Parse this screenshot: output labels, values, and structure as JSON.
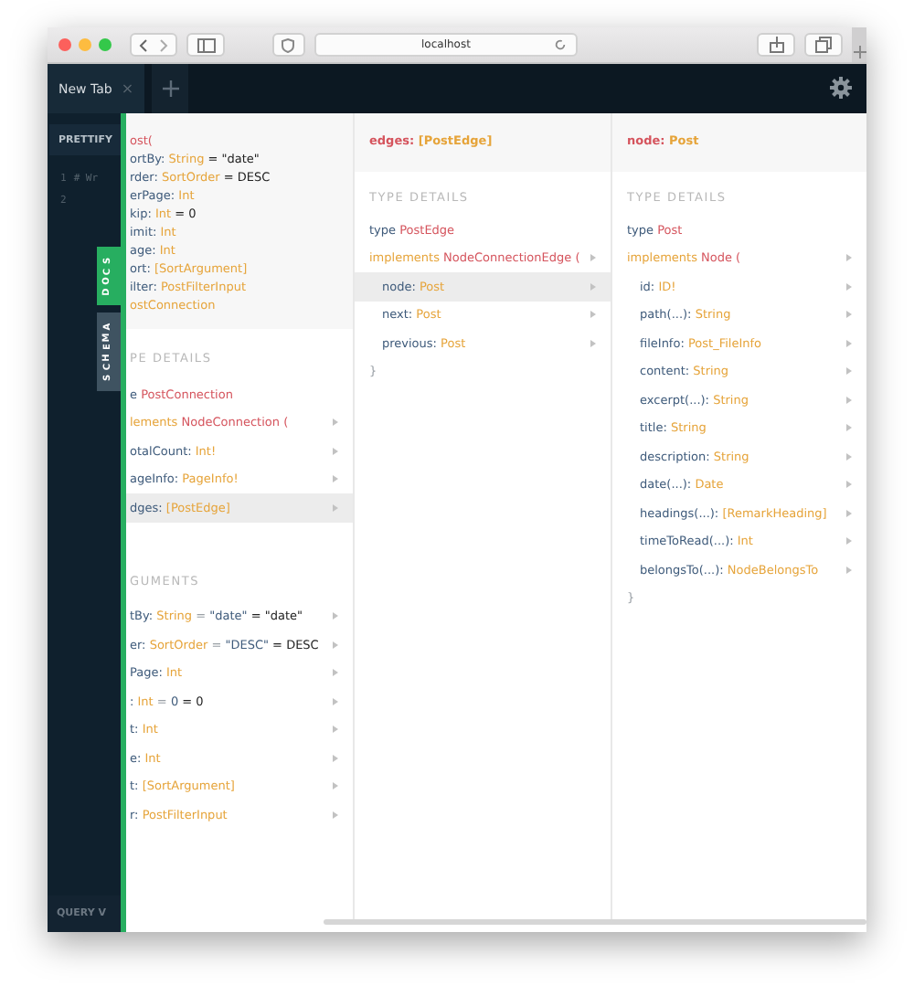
{
  "browser": {
    "url": "localhost"
  },
  "app_tabs": [
    {
      "label": "New Tab",
      "close": "×",
      "selected": true
    }
  ],
  "editor": {
    "prettify": "PRETTIFY",
    "line_numbers": [
      "1",
      "2"
    ],
    "code": [
      "# Wr"
    ],
    "bottom_label": "QUERY V"
  },
  "side_tabs": [
    {
      "label": "DOCS",
      "selected": true
    },
    {
      "label": "SCHEMA",
      "selected": false
    }
  ],
  "columns": [
    {
      "header": [
        [
          {
            "text": "ost(",
            "kind": "def"
          }
        ],
        [
          {
            "text": "ortBy: ",
            "kind": "field"
          },
          {
            "text": "String",
            "kind": "type"
          },
          {
            "text": " = \"date\"",
            "kind": "plain"
          }
        ],
        [
          {
            "text": "rder: ",
            "kind": "field"
          },
          {
            "text": "SortOrder",
            "kind": "type"
          },
          {
            "text": " = DESC",
            "kind": "plain"
          }
        ],
        [
          {
            "text": "erPage: ",
            "kind": "field"
          },
          {
            "text": "Int",
            "kind": "type"
          }
        ],
        [
          {
            "text": "kip: ",
            "kind": "field"
          },
          {
            "text": "Int",
            "kind": "type"
          },
          {
            "text": " = 0",
            "kind": "plain"
          }
        ],
        [
          {
            "text": "imit: ",
            "kind": "field"
          },
          {
            "text": "Int",
            "kind": "type"
          }
        ],
        [
          {
            "text": "age: ",
            "kind": "field"
          },
          {
            "text": "Int",
            "kind": "type"
          }
        ],
        [
          {
            "text": "ort: ",
            "kind": "field"
          },
          {
            "text": "[SortArgument]",
            "kind": "type"
          }
        ],
        [
          {
            "text": "ilter: ",
            "kind": "field"
          },
          {
            "text": "PostFilterInput",
            "kind": "type"
          }
        ],
        [
          {
            "text": "ostConnection",
            "kind": "type"
          }
        ]
      ],
      "sections": [
        {
          "title": "PE DETAILS",
          "rows": [
            {
              "parts": [
                {
                  "text": "e ",
                  "kind": "field"
                },
                {
                  "text": "PostConnection",
                  "kind": "def"
                }
              ],
              "arrow": false,
              "selected": false
            },
            {
              "parts": [
                {
                  "text": "lements ",
                  "kind": "type"
                },
                {
                  "text": "NodeConnection (",
                  "kind": "def"
                }
              ],
              "arrow": true,
              "selected": false
            },
            {
              "parts": [
                {
                  "text": "otalCount: ",
                  "kind": "field"
                },
                {
                  "text": "Int!",
                  "kind": "type"
                }
              ],
              "arrow": true,
              "selected": false
            },
            {
              "parts": [
                {
                  "text": "ageInfo: ",
                  "kind": "field"
                },
                {
                  "text": "PageInfo!",
                  "kind": "type"
                }
              ],
              "arrow": true,
              "selected": false
            },
            {
              "parts": [
                {
                  "text": "dges: ",
                  "kind": "field"
                },
                {
                  "text": "[PostEdge]",
                  "kind": "type"
                }
              ],
              "arrow": true,
              "selected": true
            }
          ]
        },
        {
          "title": "GUMENTS",
          "rows": [
            {
              "parts": [
                {
                  "text": "tBy: ",
                  "kind": "field"
                },
                {
                  "text": "String",
                  "kind": "type"
                },
                {
                  "text": " = ",
                  "kind": "muted"
                },
                {
                  "text": "\"date\"",
                  "kind": "field"
                },
                {
                  "text": " = \"date\"",
                  "kind": "plain"
                }
              ],
              "arrow": true,
              "selected": false
            },
            {
              "parts": [
                {
                  "text": "er: ",
                  "kind": "field"
                },
                {
                  "text": "SortOrder",
                  "kind": "type"
                },
                {
                  "text": " = ",
                  "kind": "muted"
                },
                {
                  "text": "\"DESC\"",
                  "kind": "field"
                },
                {
                  "text": " = DESC",
                  "kind": "plain"
                }
              ],
              "arrow": true,
              "selected": false
            },
            {
              "parts": [
                {
                  "text": "Page: ",
                  "kind": "field"
                },
                {
                  "text": "Int",
                  "kind": "type"
                }
              ],
              "arrow": true,
              "selected": false
            },
            {
              "parts": [
                {
                  "text": ": ",
                  "kind": "field"
                },
                {
                  "text": "Int",
                  "kind": "type"
                },
                {
                  "text": " = ",
                  "kind": "muted"
                },
                {
                  "text": "0",
                  "kind": "field"
                },
                {
                  "text": " = 0",
                  "kind": "plain"
                }
              ],
              "arrow": true,
              "selected": false
            },
            {
              "parts": [
                {
                  "text": "t: ",
                  "kind": "field"
                },
                {
                  "text": "Int",
                  "kind": "type"
                }
              ],
              "arrow": true,
              "selected": false
            },
            {
              "parts": [
                {
                  "text": "e: ",
                  "kind": "field"
                },
                {
                  "text": "Int",
                  "kind": "type"
                }
              ],
              "arrow": true,
              "selected": false
            },
            {
              "parts": [
                {
                  "text": "t: ",
                  "kind": "field"
                },
                {
                  "text": "[SortArgument]",
                  "kind": "type"
                }
              ],
              "arrow": true,
              "selected": false
            },
            {
              "parts": [
                {
                  "text": "r: ",
                  "kind": "field"
                },
                {
                  "text": "PostFilterInput",
                  "kind": "type"
                }
              ],
              "arrow": true,
              "selected": false
            }
          ]
        }
      ]
    },
    {
      "header": [
        [
          {
            "text": "edges: ",
            "kind": "def"
          },
          {
            "text": "[PostEdge]",
            "kind": "type"
          }
        ]
      ],
      "sections": [
        {
          "title": "TYPE DETAILS",
          "rows": [
            {
              "parts": [
                {
                  "text": "type ",
                  "kind": "field"
                },
                {
                  "text": "PostEdge",
                  "kind": "def"
                }
              ],
              "arrow": false,
              "selected": false
            },
            {
              "parts": [
                {
                  "text": "implements ",
                  "kind": "type"
                },
                {
                  "text": "NodeConnectionEdge (",
                  "kind": "def"
                }
              ],
              "arrow": true,
              "selected": false,
              "children": [
                {
                  "parts": [
                    {
                      "text": "node: ",
                      "kind": "field"
                    },
                    {
                      "text": "Post",
                      "kind": "type"
                    }
                  ],
                  "arrow": true,
                  "selected": true
                },
                {
                  "parts": [
                    {
                      "text": "next: ",
                      "kind": "field"
                    },
                    {
                      "text": "Post",
                      "kind": "type"
                    }
                  ],
                  "arrow": true,
                  "selected": false
                },
                {
                  "parts": [
                    {
                      "text": "previous: ",
                      "kind": "field"
                    },
                    {
                      "text": "Post",
                      "kind": "type"
                    }
                  ],
                  "arrow": true,
                  "selected": false
                }
              ]
            },
            {
              "parts": [
                {
                  "text": "}",
                  "kind": "muted"
                }
              ],
              "arrow": false,
              "selected": false
            }
          ]
        }
      ]
    },
    {
      "header": [
        [
          {
            "text": "node: ",
            "kind": "def"
          },
          {
            "text": "Post",
            "kind": "type"
          }
        ]
      ],
      "sections": [
        {
          "title": "TYPE DETAILS",
          "rows": [
            {
              "parts": [
                {
                  "text": "type ",
                  "kind": "field"
                },
                {
                  "text": "Post",
                  "kind": "def"
                }
              ],
              "arrow": false,
              "selected": false
            },
            {
              "parts": [
                {
                  "text": "implements ",
                  "kind": "type"
                },
                {
                  "text": "Node (",
                  "kind": "def"
                }
              ],
              "arrow": true,
              "selected": false,
              "children": [
                {
                  "parts": [
                    {
                      "text": "id: ",
                      "kind": "field"
                    },
                    {
                      "text": "ID!",
                      "kind": "type"
                    }
                  ],
                  "arrow": true,
                  "selected": false
                },
                {
                  "parts": [
                    {
                      "text": "path(...): ",
                      "kind": "field"
                    },
                    {
                      "text": "String",
                      "kind": "type"
                    }
                  ],
                  "arrow": true,
                  "selected": false
                },
                {
                  "parts": [
                    {
                      "text": "fileInfo: ",
                      "kind": "field"
                    },
                    {
                      "text": "Post_FileInfo",
                      "kind": "type"
                    }
                  ],
                  "arrow": true,
                  "selected": false
                },
                {
                  "parts": [
                    {
                      "text": "content: ",
                      "kind": "field"
                    },
                    {
                      "text": "String",
                      "kind": "type"
                    }
                  ],
                  "arrow": true,
                  "selected": false
                },
                {
                  "parts": [
                    {
                      "text": "excerpt(...): ",
                      "kind": "field"
                    },
                    {
                      "text": "String",
                      "kind": "type"
                    }
                  ],
                  "arrow": true,
                  "selected": false
                },
                {
                  "parts": [
                    {
                      "text": "title: ",
                      "kind": "field"
                    },
                    {
                      "text": "String",
                      "kind": "type"
                    }
                  ],
                  "arrow": true,
                  "selected": false
                },
                {
                  "parts": [
                    {
                      "text": "description: ",
                      "kind": "field"
                    },
                    {
                      "text": "String",
                      "kind": "type"
                    }
                  ],
                  "arrow": true,
                  "selected": false
                },
                {
                  "parts": [
                    {
                      "text": "date(...): ",
                      "kind": "field"
                    },
                    {
                      "text": "Date",
                      "kind": "type"
                    }
                  ],
                  "arrow": true,
                  "selected": false
                },
                {
                  "parts": [
                    {
                      "text": "headings(...): ",
                      "kind": "field"
                    },
                    {
                      "text": "[RemarkHeading]",
                      "kind": "type"
                    }
                  ],
                  "arrow": true,
                  "selected": false
                },
                {
                  "parts": [
                    {
                      "text": "timeToRead(...): ",
                      "kind": "field"
                    },
                    {
                      "text": "Int",
                      "kind": "type"
                    }
                  ],
                  "arrow": true,
                  "selected": false
                },
                {
                  "parts": [
                    {
                      "text": "belongsTo(...): ",
                      "kind": "field"
                    },
                    {
                      "text": "NodeBelongsTo",
                      "kind": "type"
                    }
                  ],
                  "arrow": true,
                  "selected": false
                }
              ]
            },
            {
              "parts": [
                {
                  "text": "}",
                  "kind": "muted"
                }
              ],
              "arrow": false,
              "selected": false
            }
          ]
        }
      ]
    }
  ]
}
